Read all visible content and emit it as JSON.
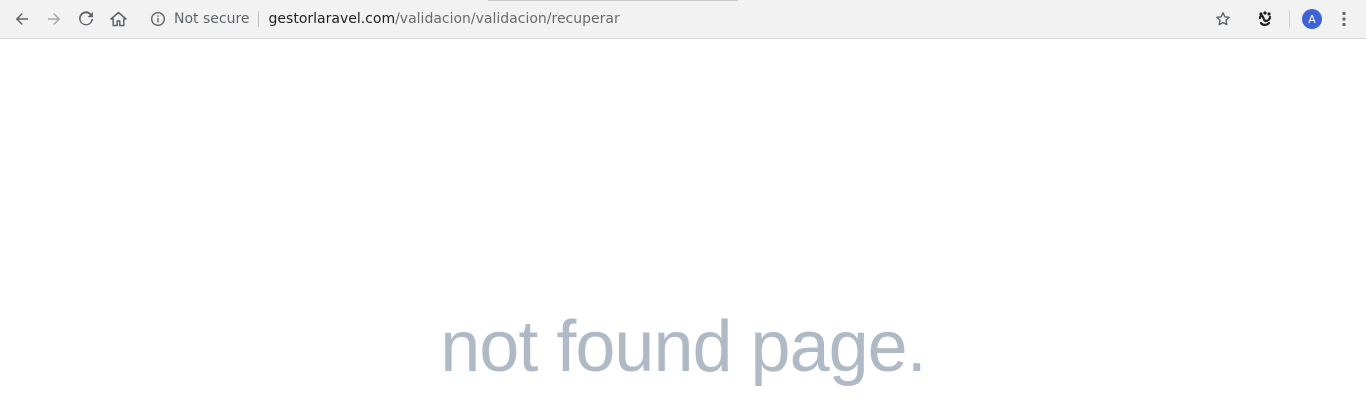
{
  "browser": {
    "security_label": "Not secure",
    "url_host": "gestorlaravel.com",
    "url_path": "/validacion/validacion/recuperar",
    "profile_initial": "A",
    "icons": {
      "back": "arrow-left-icon",
      "forward": "arrow-right-icon",
      "reload": "reload-icon",
      "home": "home-icon",
      "info": "info-icon",
      "bookmark": "star-icon",
      "extension": "extension-icon",
      "menu": "kebab-menu-icon"
    },
    "colors": {
      "avatar": "#3e63d6",
      "toolbar": "#f2f2f2"
    }
  },
  "page": {
    "message": "not found page."
  },
  "colors": {
    "message": "#b0bac6"
  }
}
